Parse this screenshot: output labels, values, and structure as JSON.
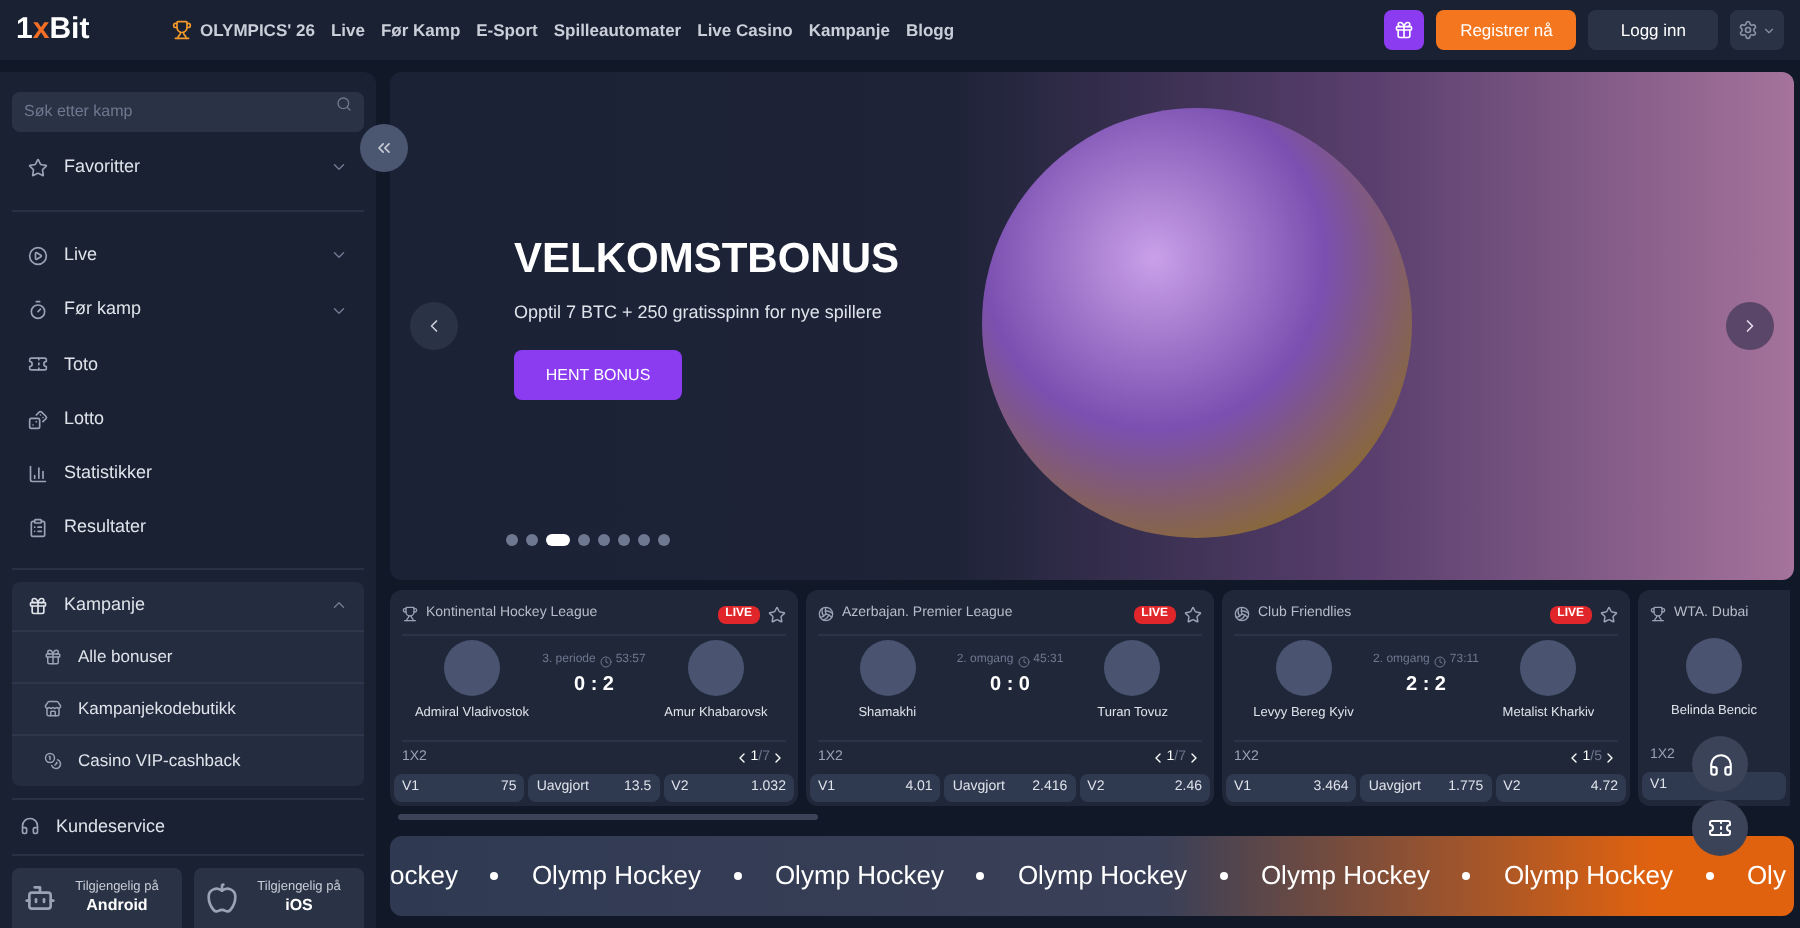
{
  "header": {
    "logo": {
      "digit": "1",
      "mark": "x",
      "name": "Bit"
    },
    "nav": [
      {
        "label": "OLYMPICS' 26",
        "kind": "olympics"
      },
      {
        "label": "Live",
        "kind": "link"
      },
      {
        "label": "Før Kamp",
        "kind": "link"
      },
      {
        "label": "E-Sport",
        "kind": "link"
      },
      {
        "label": "Spilleautomater",
        "kind": "link"
      },
      {
        "label": "Live Casino",
        "kind": "link"
      },
      {
        "label": "Kampanje",
        "kind": "link"
      },
      {
        "label": "Blogg",
        "kind": "link"
      }
    ],
    "register": "Registrer nå",
    "login": "Logg inn"
  },
  "sidebar": {
    "search": {
      "placeholder": "Søk etter kamp"
    },
    "items": [
      {
        "label": "Favoritter",
        "kind": "group",
        "expanded": false
      },
      {
        "label": "Live",
        "kind": "group",
        "expanded": false
      },
      {
        "label": "Før kamp",
        "kind": "group",
        "expanded": false
      },
      {
        "label": "Toto",
        "kind": "link",
        "expanded": false
      },
      {
        "label": "Lotto",
        "kind": "link",
        "expanded": false
      },
      {
        "label": "Statistikker",
        "kind": "link",
        "expanded": false
      },
      {
        "label": "Resultater",
        "kind": "link",
        "expanded": false
      }
    ],
    "promo": {
      "label": "Kampanje",
      "expanded": true,
      "children": [
        {
          "label": "Alle bonuser"
        },
        {
          "label": "Kampanjekodebutikk"
        },
        {
          "label": "Casino VIP-cashback"
        }
      ]
    },
    "support": "Kundeservice",
    "apps": [
      {
        "caption": "Tilgjengelig på",
        "platform": "Android",
        "kind": "android"
      },
      {
        "caption": "Tilgjengelig på",
        "platform": "iOS",
        "kind": "apple"
      }
    ]
  },
  "banner": {
    "title": "VELKOMSTBONUS",
    "subtitle": "Opptil 7 BTC + 250 gratisspinn for nye spillere",
    "button": "HENT BONUS",
    "dots": [
      {
        "selected": false
      },
      {
        "selected": false
      },
      {
        "selected": true
      },
      {
        "selected": false
      },
      {
        "selected": false
      },
      {
        "selected": false
      },
      {
        "selected": false
      },
      {
        "selected": false
      }
    ]
  },
  "matches": [
    {
      "league": "Kontinental Hockey League",
      "live": "LIVE",
      "home": "Admiral Vladivostok",
      "away": "Amur Khabarovsk",
      "period": "3. periode",
      "clock": "53:57",
      "score": "0 : 2",
      "market": "1X2",
      "page": "1",
      "pages": "/7",
      "odds": [
        {
          "label": "V1",
          "value": "75"
        },
        {
          "label": "Uavgjort",
          "value": "13.5"
        },
        {
          "label": "V2",
          "value": "1.032"
        }
      ]
    },
    {
      "league": "Azerbajan. Premier League",
      "live": "LIVE",
      "home": "Shamakhi",
      "away": "Turan Tovuz",
      "period": "2. omgang",
      "clock": "45:31",
      "score": "0 : 0",
      "market": "1X2",
      "page": "1",
      "pages": "/7",
      "odds": [
        {
          "label": "V1",
          "value": "4.01"
        },
        {
          "label": "Uavgjort",
          "value": "2.416"
        },
        {
          "label": "V2",
          "value": "2.46"
        }
      ]
    },
    {
      "league": "Club Friendlies",
      "live": "LIVE",
      "home": "Levyy Bereg Kyiv",
      "away": "Metalist Kharkiv",
      "period": "2. omgang",
      "clock": "73:11",
      "score": "2 : 2",
      "market": "1X2",
      "page": "1",
      "pages": "/5",
      "odds": [
        {
          "label": "V1",
          "value": "3.464"
        },
        {
          "label": "Uavgjort",
          "value": "1.775"
        },
        {
          "label": "V2",
          "value": "4.72"
        }
      ]
    }
  ],
  "partial_match": {
    "league": "WTA. Dubai",
    "player": "Belinda Bencic",
    "market": "1X2",
    "odd_label": "V1"
  },
  "ticker": {
    "items": [
      "ockey",
      "Olymp Hockey",
      "Olymp Hockey",
      "Olymp Hockey",
      "Olymp Hockey",
      "Olymp Hockey",
      "Oly"
    ]
  }
}
